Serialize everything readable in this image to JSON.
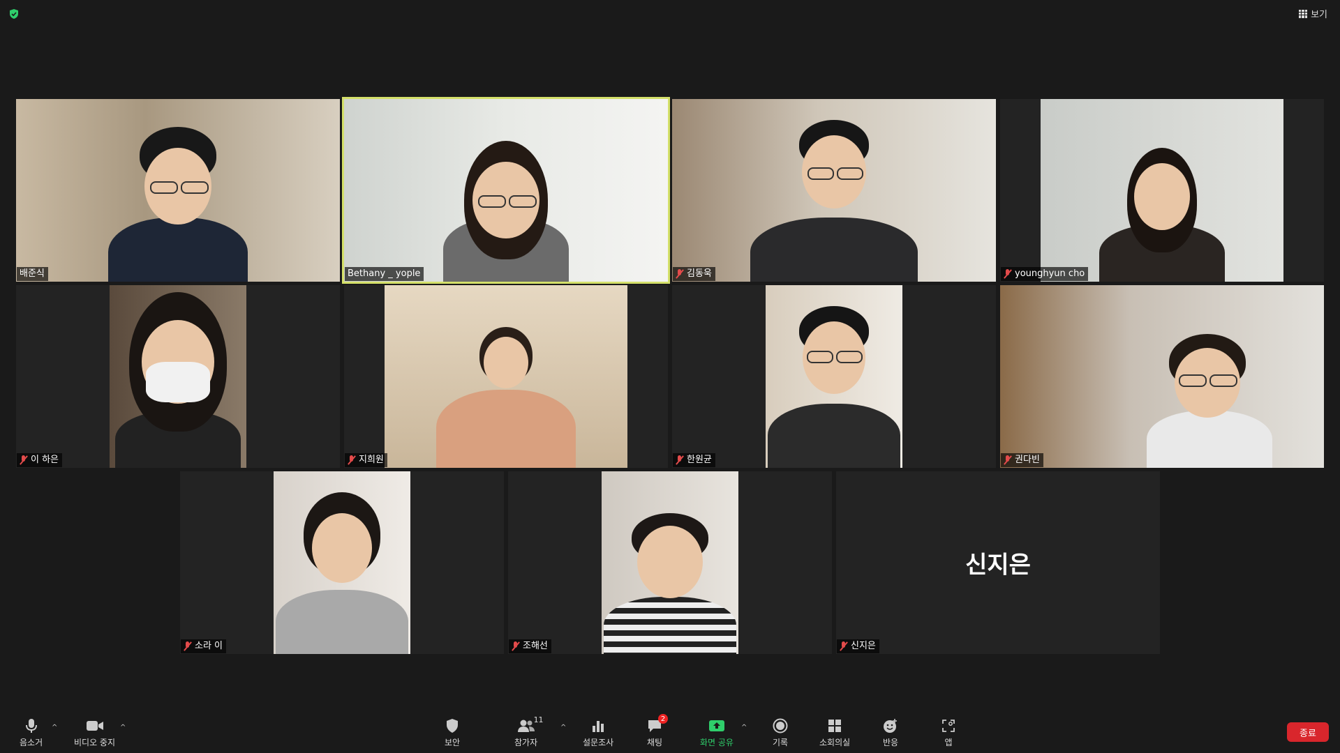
{
  "top": {
    "view_label": "보기"
  },
  "participants": [
    {
      "name": "배준식",
      "muted": false,
      "video": true,
      "active": false
    },
    {
      "name": "Bethany _ yople",
      "muted": false,
      "video": true,
      "active": true
    },
    {
      "name": "김동욱",
      "muted": true,
      "video": true,
      "active": false
    },
    {
      "name": "younghyun cho",
      "muted": true,
      "video": true,
      "active": false
    },
    {
      "name": "이 하은",
      "muted": true,
      "video": true,
      "active": false
    },
    {
      "name": "지희원",
      "muted": true,
      "video": true,
      "active": false
    },
    {
      "name": "한원균",
      "muted": true,
      "video": true,
      "active": false
    },
    {
      "name": "권다빈",
      "muted": true,
      "video": true,
      "active": false
    },
    {
      "name": "소라 이",
      "muted": true,
      "video": true,
      "active": false
    },
    {
      "name": "조해선",
      "muted": true,
      "video": true,
      "active": false
    },
    {
      "name": "신지은",
      "muted": true,
      "video": false,
      "active": false,
      "display_name": "신지은"
    }
  ],
  "toolbar": {
    "mute_label": "음소거",
    "video_label": "비디오 중지",
    "security_label": "보안",
    "participants_label": "참가자",
    "participants_count": "11",
    "polls_label": "설문조사",
    "chat_label": "채팅",
    "chat_badge": "2",
    "share_label": "화면 공유",
    "record_label": "기록",
    "breakout_label": "소회의실",
    "reactions_label": "반응",
    "apps_label": "앱",
    "end_label": "종료"
  },
  "colors": {
    "accent_active": "#d4e06a",
    "share_green": "#2fce6b",
    "end_red": "#d9262c",
    "mute_red": "#e34b4b"
  }
}
